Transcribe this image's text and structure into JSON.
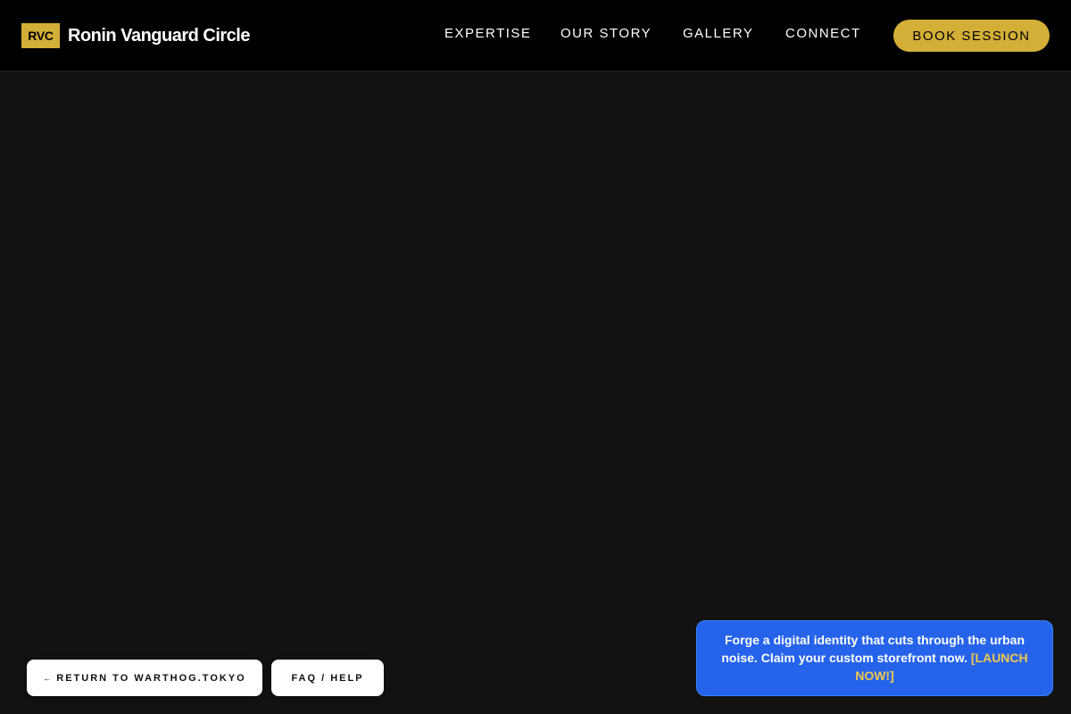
{
  "header": {
    "logo_initials": "RVC",
    "brand_name": "Ronin Vanguard Circle",
    "nav": {
      "expertise": "EXPERTISE",
      "our_story": "OUR STORY",
      "gallery": "GALLERY",
      "connect": "CONNECT"
    },
    "book_button": "BOOK SESSION"
  },
  "footer_buttons": {
    "return_arrow": "←",
    "return_label": "RETURN TO WARTHOG.TOKYO",
    "faq_label": "FAQ / HELP"
  },
  "promo": {
    "message": "Forge a digital identity that cuts through the urban noise. Claim your custom storefront now.",
    "cta": "[LAUNCH NOW!]"
  },
  "colors": {
    "background": "#121212",
    "header_bg": "#000000",
    "accent_gold": "#d4af37",
    "promo_blue": "#2563eb",
    "cta_yellow": "#f2c94c"
  },
  "icons": {
    "return_arrow": "left-arrow-icon"
  }
}
